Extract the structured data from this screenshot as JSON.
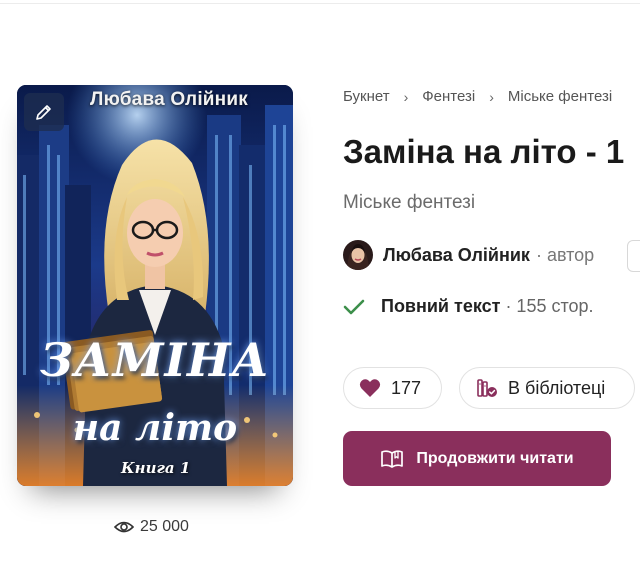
{
  "breadcrumb": {
    "items": [
      "Букнет",
      "Фентезі",
      "Міське фентезі"
    ],
    "separator": "›"
  },
  "book": {
    "title": "Заміна на літо - 1",
    "genre": "Міське фентезі",
    "views": "25 000",
    "cover": {
      "author_text": "Любава Олійник",
      "title_line1": "ЗАМІНА",
      "title_line2": "на літо",
      "series_text": "Книга 1"
    }
  },
  "author": {
    "name": "Любава Олійник",
    "role": "· автор"
  },
  "status": {
    "label": "Повний текст",
    "pages": "· 155 стор."
  },
  "actions": {
    "likes": "177",
    "library_label": "В бібліотеці",
    "read_label": "Продовжити читати"
  },
  "icons": {
    "edit": "pencil-icon",
    "views": "eye-icon",
    "status": "check-icon",
    "like": "heart-icon",
    "library": "bookshelf-icon",
    "read": "open-book-icon"
  },
  "colors": {
    "accent": "#8a2f5c",
    "check": "#3c8f4a",
    "heart": "#8a2f5c"
  }
}
